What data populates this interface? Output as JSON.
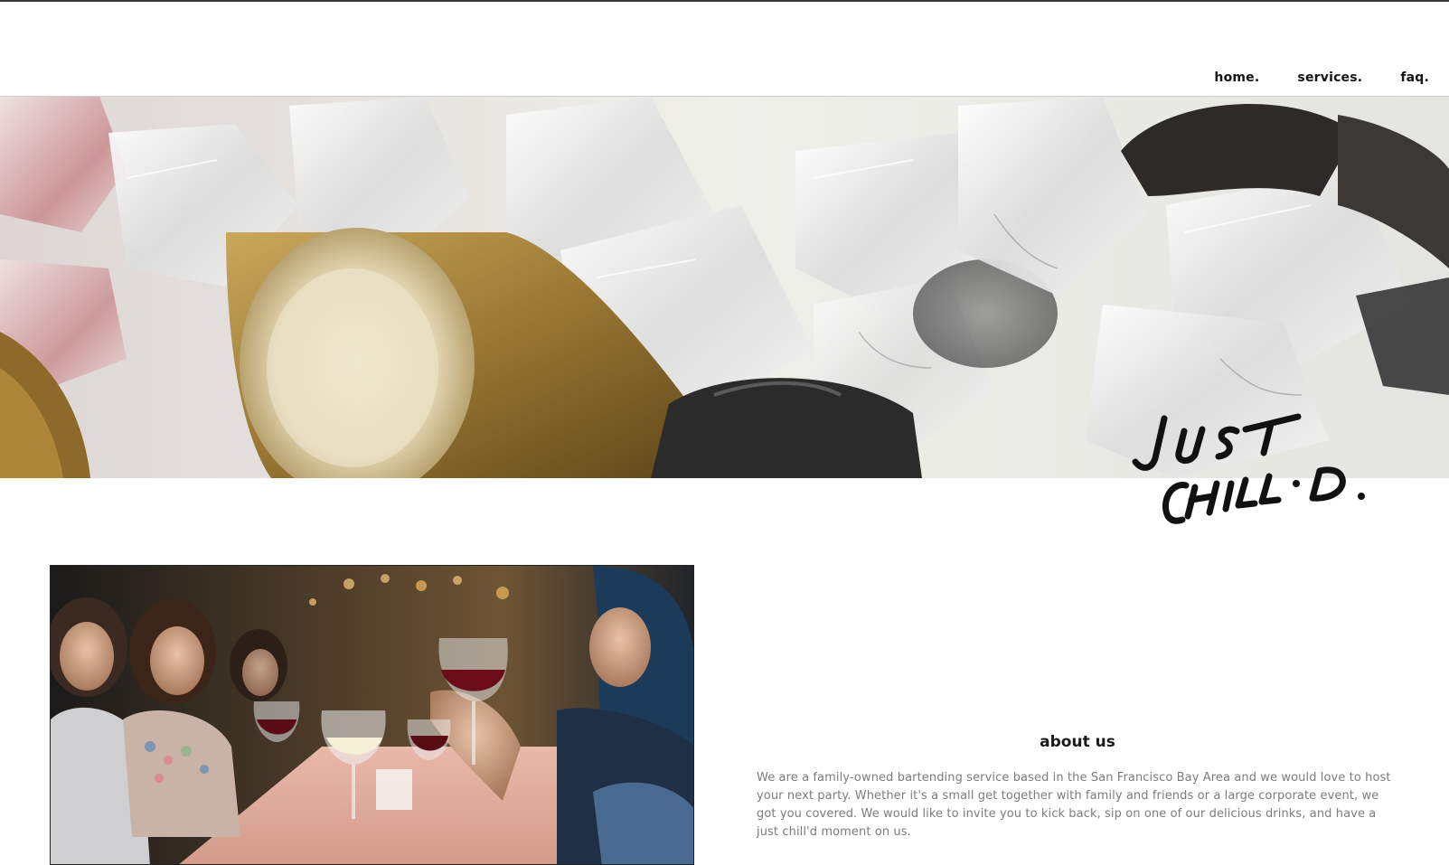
{
  "nav": {
    "items": [
      {
        "label": "home."
      },
      {
        "label": "services."
      },
      {
        "label": "faq."
      }
    ]
  },
  "hero": {
    "image": "ice-bucket-bottle-photo"
  },
  "logo": {
    "line1": "JUST",
    "line2": "CHILL·D."
  },
  "about": {
    "image": "friends-drinking-wine-photo",
    "title": "about us",
    "body": "We are a family-owned bartending service based in the San Francisco Bay Area and we would love to host your next party. Whether it's a small get together with family and friends or a large corporate event, we got you covered. We would like to invite you to kick back, sip on one of our delicious drinks, and have a just chill'd moment on us."
  },
  "colors": {
    "nav_text": "#141414",
    "body_text": "#7c7c7c",
    "title_text": "#1a1a1a"
  }
}
